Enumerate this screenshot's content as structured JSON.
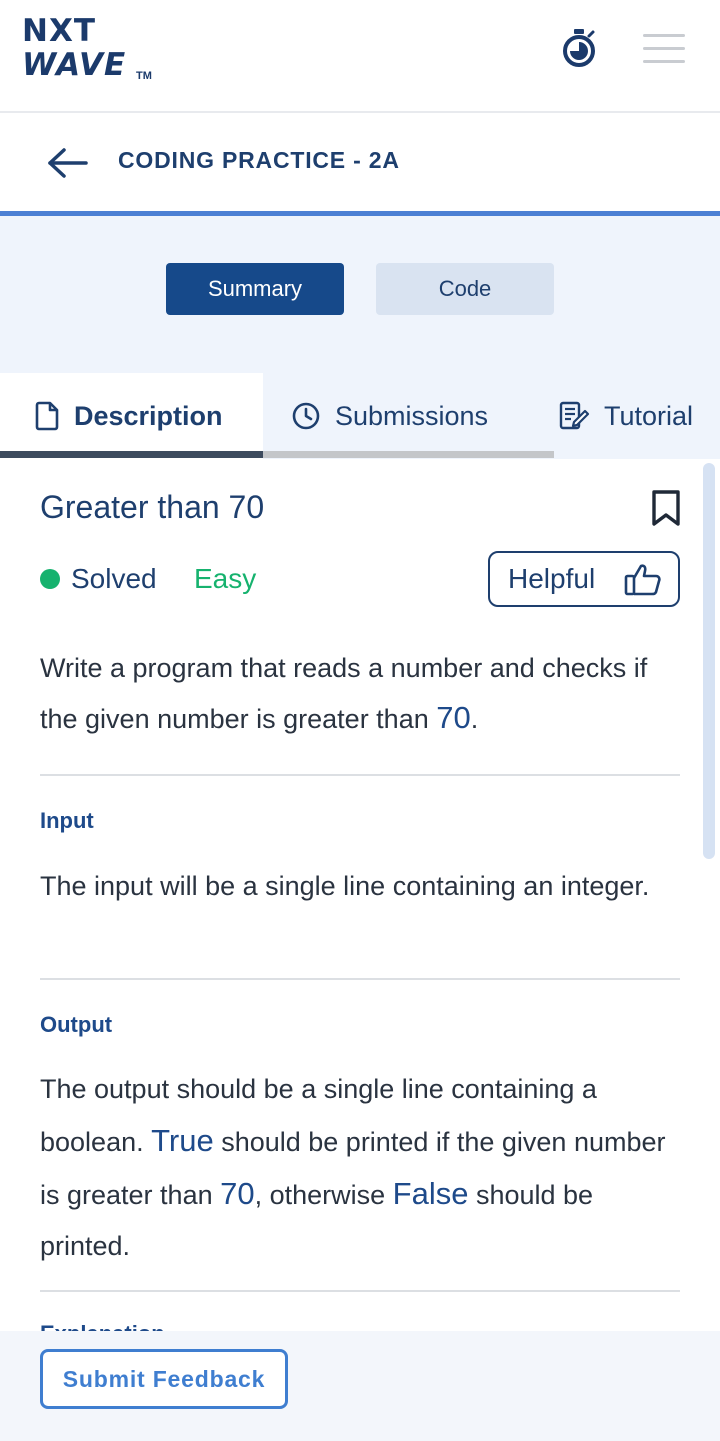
{
  "header": {
    "logo_line1": "NXT",
    "logo_line2": "WAVE",
    "logo_tm": "TM",
    "timer_icon": "stopwatch-icon",
    "menu_icon": "hamburger-menu-icon"
  },
  "subheader": {
    "back_icon": "arrow-left-icon",
    "title": "CODING PRACTICE - 2A"
  },
  "toggle": {
    "summary_label": "Summary",
    "code_label": "Code",
    "active": "Summary"
  },
  "tabs": [
    {
      "label": "Description",
      "icon": "document-icon",
      "active": true
    },
    {
      "label": "Submissions",
      "icon": "clock-icon",
      "active": false
    },
    {
      "label": "Tutorial",
      "icon": "notes-icon",
      "active": false
    }
  ],
  "problem": {
    "title": "Greater than 70",
    "status": "Solved",
    "difficulty": "Easy",
    "helpful_label": "Helpful",
    "description": {
      "part1": "Write a program that reads a number and checks if the given number is greater than ",
      "highlight": "70",
      "part2": "."
    },
    "input_label": "Input",
    "input_text": "The input will be a single line containing an integer.",
    "output_label": "Output",
    "output_text": {
      "a": "The output should be a single line containing a boolean. ",
      "true_word": "True",
      "b": " should be printed if the given number is greater than ",
      "num": "70",
      "c": ", otherwise ",
      "false_word": "False",
      "d": " should be printed."
    },
    "next_section_peek": "Explanation"
  },
  "footer": {
    "feedback_label": "Submit Feedback"
  },
  "colors": {
    "brand_navy": "#16498a",
    "accent_blue": "#4c80d4",
    "success_green": "#16b26e",
    "text_navy": "#1e3f6e"
  }
}
